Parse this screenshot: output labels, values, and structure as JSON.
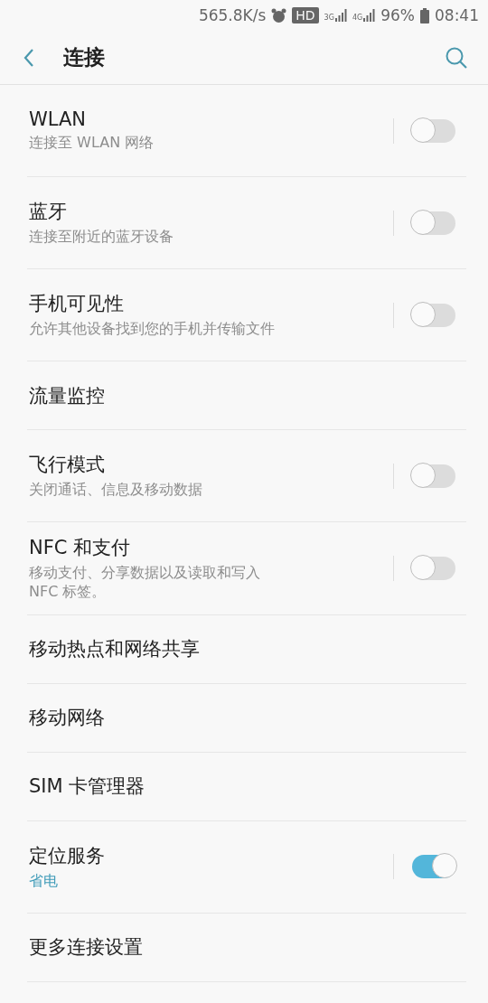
{
  "status_bar": {
    "speed": "565.8K/s",
    "hd_badge": "HD",
    "sim1_network": "3G",
    "sim2_network": "4G",
    "battery": "96%",
    "time": "08:41"
  },
  "header": {
    "title": "连接"
  },
  "items": [
    {
      "kind": "toggle",
      "title": "WLAN",
      "subtitle": "连接至 WLAN 网络",
      "on": false
    },
    {
      "kind": "toggle",
      "title": "蓝牙",
      "subtitle": "连接至附近的蓝牙设备",
      "on": false
    },
    {
      "kind": "toggle",
      "title": "手机可见性",
      "subtitle": "允许其他设备找到您的手机并传输文件",
      "on": false
    },
    {
      "kind": "link",
      "title": "流量监控"
    },
    {
      "kind": "toggle",
      "title": "飞行模式",
      "subtitle": "关闭通话、信息及移动数据",
      "on": false
    },
    {
      "kind": "toggle",
      "title": "NFC 和支付",
      "subtitle": "移动支付、分享数据以及读取和写入 NFC 标签。",
      "on": false
    },
    {
      "kind": "link",
      "title": "移动热点和网络共享"
    },
    {
      "kind": "link",
      "title": "移动网络"
    },
    {
      "kind": "link",
      "title": "SIM 卡管理器"
    },
    {
      "kind": "toggle",
      "title": "定位服务",
      "subtitle": "省电",
      "on": true
    },
    {
      "kind": "link",
      "title": "更多连接设置"
    }
  ]
}
